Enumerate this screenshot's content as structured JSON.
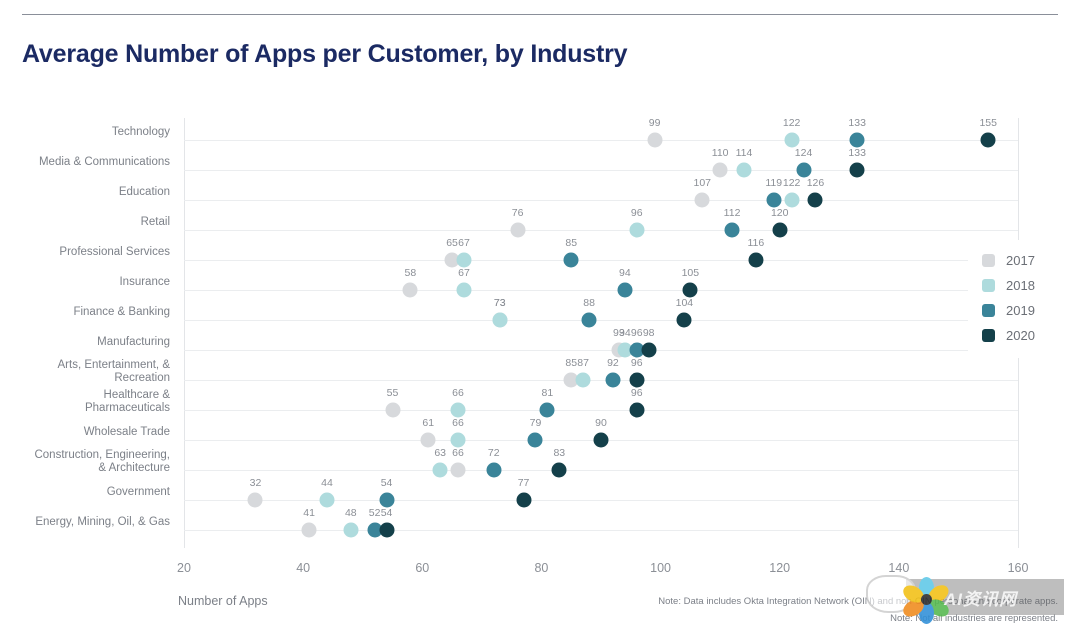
{
  "chart_title": "Average Number of Apps per Customer, by Industry",
  "x_axis_title": "Number of Apps",
  "notes": {
    "note_1": "Note: Data includes Okta Integration Network (OIN) and non-OIN personal and corporate apps.",
    "note_2": "Note: Not all industries are represented."
  },
  "legend": {
    "items": [
      {
        "label": "2017",
        "color": "#d7d9dc"
      },
      {
        "label": "2018",
        "color": "#aedbdd"
      },
      {
        "label": "2019",
        "color": "#3a8499"
      },
      {
        "label": "2020",
        "color": "#14404a"
      }
    ]
  },
  "watermark": {
    "text": "AI资讯网"
  },
  "chart_data": {
    "type": "scatter",
    "title": "Average Number of Apps per Customer, by Industry",
    "xlabel": "Number of Apps",
    "ylabel": "",
    "xlim": [
      20,
      160
    ],
    "xticks": [
      20,
      40,
      60,
      80,
      100,
      120,
      140,
      160
    ],
    "grid": true,
    "legend_position": "right",
    "series": [
      {
        "name": "2017",
        "color": "#d7d9dc"
      },
      {
        "name": "2018",
        "color": "#aedbdd"
      },
      {
        "name": "2019",
        "color": "#3a8499"
      },
      {
        "name": "2020",
        "color": "#14404a"
      }
    ],
    "categories": [
      "Technology",
      "Media & Communications",
      "Education",
      "Retail",
      "Professional Services",
      "Insurance",
      "Finance & Banking",
      "Manufacturing",
      "Arts, Entertainment, & Recreation",
      "Healthcare & Pharmaceuticals",
      "Wholesale Trade",
      "Construction, Engineering, & Architecture",
      "Government",
      "Energy, Mining, Oil, & Gas"
    ],
    "rows": [
      {
        "category": "Technology",
        "label_lines": [
          "Technology"
        ],
        "points": [
          {
            "year": "2017",
            "value": 99
          },
          {
            "year": "2018",
            "value": 122
          },
          {
            "year": "2019",
            "value": 133
          },
          {
            "year": "2020",
            "value": 155
          }
        ]
      },
      {
        "category": "Media & Communications",
        "label_lines": [
          "Media & Communications"
        ],
        "points": [
          {
            "year": "2017",
            "value": 110
          },
          {
            "year": "2018",
            "value": 114
          },
          {
            "year": "2019",
            "value": 124
          },
          {
            "year": "2020",
            "value": 133
          }
        ]
      },
      {
        "category": "Education",
        "label_lines": [
          "Education"
        ],
        "points": [
          {
            "year": "2017",
            "value": 107
          },
          {
            "year": "2019",
            "value": 119
          },
          {
            "year": "2018",
            "value": 122
          },
          {
            "year": "2020",
            "value": 126
          }
        ]
      },
      {
        "category": "Retail",
        "label_lines": [
          "Retail"
        ],
        "points": [
          {
            "year": "2017",
            "value": 76
          },
          {
            "year": "2018",
            "value": 96
          },
          {
            "year": "2019",
            "value": 112
          },
          {
            "year": "2020",
            "value": 120
          }
        ]
      },
      {
        "category": "Professional Services",
        "label_lines": [
          "Professional Services"
        ],
        "points": [
          {
            "year": "2017",
            "value": 65
          },
          {
            "year": "2018",
            "value": 67
          },
          {
            "year": "2019",
            "value": 85
          },
          {
            "year": "2020",
            "value": 116
          }
        ]
      },
      {
        "category": "Insurance",
        "label_lines": [
          "Insurance"
        ],
        "points": [
          {
            "year": "2017",
            "value": 58
          },
          {
            "year": "2018",
            "value": 67
          },
          {
            "year": "2019",
            "value": 94
          },
          {
            "year": "2020",
            "value": 105
          }
        ]
      },
      {
        "category": "Finance & Banking",
        "label_lines": [
          "Finance & Banking"
        ],
        "points": [
          {
            "year": "2017",
            "value": 73
          },
          {
            "year": "2018",
            "value": 73
          },
          {
            "year": "2019",
            "value": 88
          },
          {
            "year": "2020",
            "value": 104
          }
        ]
      },
      {
        "category": "Manufacturing",
        "label_lines": [
          "Manufacturing"
        ],
        "points": [
          {
            "year": "2017",
            "value": 93
          },
          {
            "year": "2018",
            "value": 94
          },
          {
            "year": "2019",
            "value": 96
          },
          {
            "year": "2020",
            "value": 98
          }
        ]
      },
      {
        "category": "Arts, Entertainment, & Recreation",
        "label_lines": [
          "Arts, Entertainment, &",
          "Recreation"
        ],
        "points": [
          {
            "year": "2017",
            "value": 85
          },
          {
            "year": "2018",
            "value": 87
          },
          {
            "year": "2019",
            "value": 92
          },
          {
            "year": "2020",
            "value": 96
          }
        ]
      },
      {
        "category": "Healthcare & Pharmaceuticals",
        "label_lines": [
          "Healthcare &",
          "Pharmaceuticals"
        ],
        "points": [
          {
            "year": "2017",
            "value": 55
          },
          {
            "year": "2018",
            "value": 66
          },
          {
            "year": "2019",
            "value": 81
          },
          {
            "year": "2020",
            "value": 96
          }
        ]
      },
      {
        "category": "Wholesale Trade",
        "label_lines": [
          "Wholesale Trade"
        ],
        "points": [
          {
            "year": "2017",
            "value": 61
          },
          {
            "year": "2018",
            "value": 66
          },
          {
            "year": "2019",
            "value": 79
          },
          {
            "year": "2020",
            "value": 90
          }
        ]
      },
      {
        "category": "Construction, Engineering, & Architecture",
        "label_lines": [
          "Construction, Engineering,",
          "& Architecture"
        ],
        "points": [
          {
            "year": "2018",
            "value": 63
          },
          {
            "year": "2017",
            "value": 66
          },
          {
            "year": "2019",
            "value": 72
          },
          {
            "year": "2020",
            "value": 83
          }
        ]
      },
      {
        "category": "Government",
        "label_lines": [
          "Government"
        ],
        "points": [
          {
            "year": "2017",
            "value": 32
          },
          {
            "year": "2018",
            "value": 44
          },
          {
            "year": "2019",
            "value": 54
          },
          {
            "year": "2020",
            "value": 77
          }
        ]
      },
      {
        "category": "Energy, Mining, Oil, & Gas",
        "label_lines": [
          "Energy, Mining, Oil, & Gas"
        ],
        "points": [
          {
            "year": "2017",
            "value": 41
          },
          {
            "year": "2018",
            "value": 48
          },
          {
            "year": "2019",
            "value": 52
          },
          {
            "year": "2020",
            "value": 54
          }
        ]
      }
    ]
  }
}
